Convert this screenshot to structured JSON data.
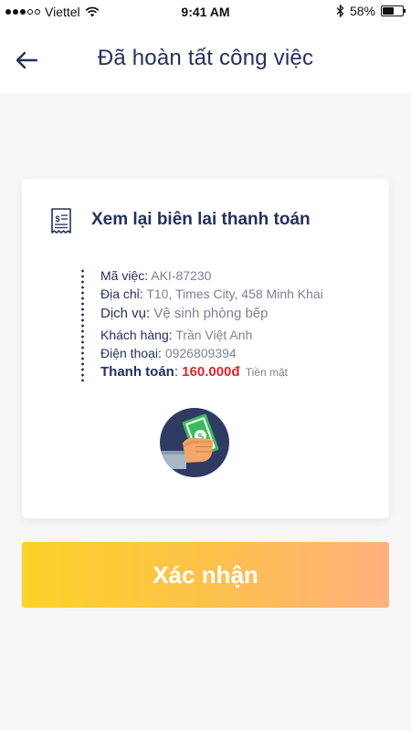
{
  "status_bar": {
    "carrier": "Viettel",
    "time": "9:41 AM",
    "battery": "58%",
    "battery_level": 0.58,
    "icons": [
      "signal-dots-icon",
      "wifi-icon",
      "bluetooth-icon",
      "battery-icon"
    ]
  },
  "header": {
    "title": "Đã hoàn tất công việc",
    "back_icon": "back-arrow-icon"
  },
  "receipt": {
    "icon": "receipt-icon",
    "title": "Xem lại biên lai thanh toán",
    "job_code_label": "Mã việc",
    "job_code": "AKI-87230",
    "address_label": "Địa chỉ",
    "address": "T10, Times City, 458 Minh Khai",
    "service_label": "Dịch vụ",
    "service": "Vệ sinh phòng bếp",
    "customer_label": "Khách hàng",
    "customer": "Trần Việt Anh",
    "phone_label": "Điện thoại",
    "phone": "0926809394",
    "payment_label": "Thanh toán",
    "payment_amount": "160.000đ",
    "payment_method": "Tiền mặt",
    "illustration": "hand-holding-cash-icon"
  },
  "confirm_button": {
    "label": "Xác nhận"
  },
  "colors": {
    "primary_text": "#24305e",
    "secondary_text": "#7b8294",
    "amount": "#e0262b",
    "button_gradient_start": "#fdd22a",
    "button_gradient_end": "#ffb07c",
    "background": "#f7f7f8",
    "illustration_bg": "#2f3b63",
    "cash_green": "#3dbb5c"
  }
}
